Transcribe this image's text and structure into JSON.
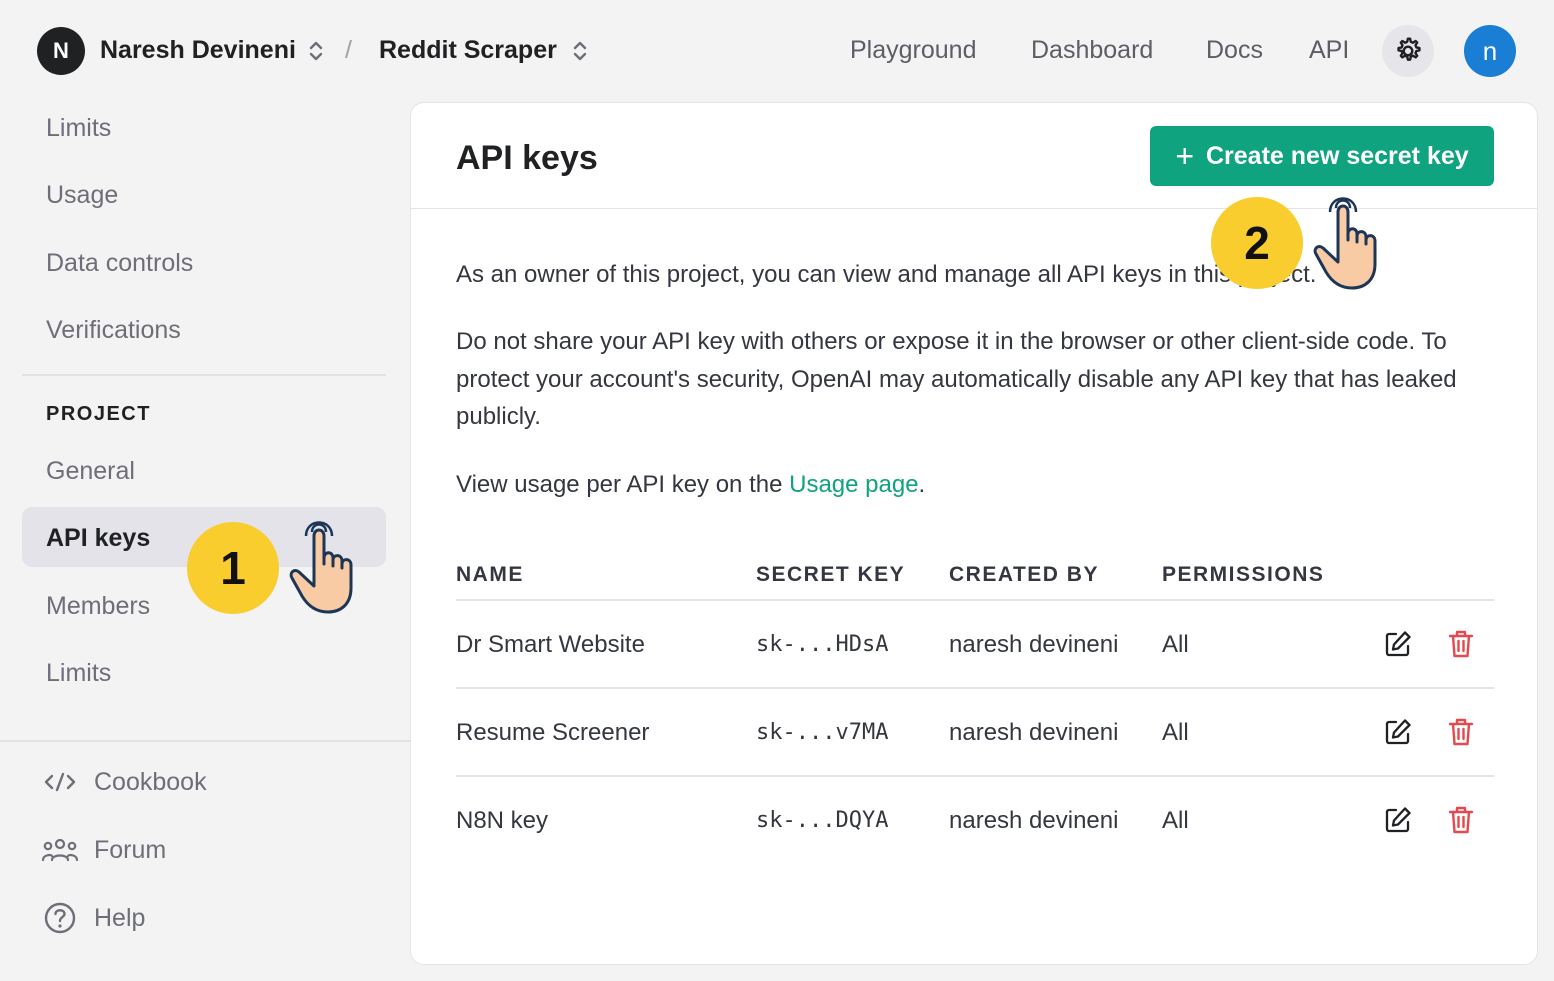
{
  "header": {
    "org_initial": "N",
    "org_name": "Naresh Devineni",
    "separator": "/",
    "project_name": "Reddit Scraper",
    "nav": [
      "Playground",
      "Dashboard",
      "Docs",
      "API"
    ],
    "user_initial": "n"
  },
  "sidebar": {
    "top_items": [
      "Limits",
      "Usage",
      "Data controls",
      "Verifications"
    ],
    "project_heading": "PROJECT",
    "project_items": [
      "General",
      "API keys",
      "Members",
      "Limits"
    ],
    "active_item": "API keys",
    "bottom_items": [
      "Cookbook",
      "Forum",
      "Help"
    ]
  },
  "main": {
    "title": "API keys",
    "create_button": "Create new secret key",
    "para1": "As an owner of this project, you can view and manage all API keys in this project.",
    "para2": "Do not share your API key with others or expose it in the browser or other client-side code. To protect your account's security, OpenAI may automatically disable any API key that has leaked publicly.",
    "para3_prefix": "View usage per API key on the ",
    "para3_link": "Usage page",
    "para3_suffix": ".",
    "table": {
      "headers": [
        "NAME",
        "SECRET KEY",
        "CREATED BY",
        "PERMISSIONS"
      ],
      "rows": [
        {
          "name": "Dr Smart Website",
          "key": "sk-...HDsA",
          "created_by": "naresh devineni",
          "permissions": "All"
        },
        {
          "name": "Resume Screener",
          "key": "sk-...v7MA",
          "created_by": "naresh devineni",
          "permissions": "All"
        },
        {
          "name": "N8N key",
          "key": "sk-...DQYA",
          "created_by": "naresh devineni",
          "permissions": "All"
        }
      ]
    }
  },
  "callouts": {
    "step1": "1",
    "step2": "2"
  },
  "colors": {
    "accent": "#10a37f",
    "danger": "#e5484d",
    "callout": "#f8cd2d",
    "user_avatar": "#1a7fd4"
  },
  "icons": [
    "chevron-up-down-icon",
    "gear-icon",
    "plus-icon",
    "edit-icon",
    "trash-icon",
    "code-icon",
    "people-icon",
    "help-icon",
    "pointer-hand-icon"
  ]
}
